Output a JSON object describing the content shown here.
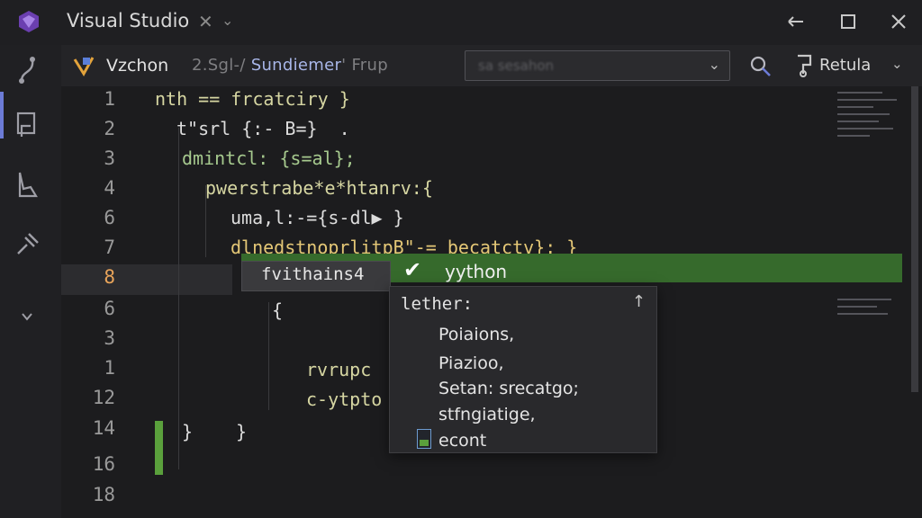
{
  "window": {
    "title": "Visual Studio",
    "close_glyph": "✕",
    "chevron_glyph": "⌄"
  },
  "toolbar": {
    "file_name": "Vzchon",
    "path_prefix": "2.Sgl-/",
    "path_highlight": "Sundiemer",
    "path_suffix": "' Frup",
    "dropdown_value": "sa sesahon",
    "run_label": "Retula"
  },
  "editor": {
    "current_line_number": "8",
    "line_numbers": [
      "1",
      "2",
      "3",
      "4",
      "6",
      "7",
      "8",
      "6",
      "3",
      "1",
      "12",
      "14",
      "16",
      "18"
    ],
    "lines": [
      "nth == frcatciry }",
      "t\"srl {:- B=}  .",
      "dmintcl: {s=al};",
      "pwerstrabe*e*htanrv:{",
      "uma,l:-={s-dl▶ }",
      "dlnedstnoprlitpB\"-= becatctv}: }",
      "fvithains4",
      "{",
      "",
      "rvrupc",
      "c-ytpto",
      "}",
      "}",
      ""
    ]
  },
  "suggestion": {
    "input_text": "fvithains4",
    "label": "yython"
  },
  "popup": {
    "header": "lether:",
    "items": [
      "Poiaions,",
      "Piazioo,",
      "Setan: srecatgo;",
      "stfngiatige,",
      "econt"
    ]
  },
  "colors": {
    "accent": "#6c7bd6",
    "suggest_green": "#366a2c",
    "gutter_green": "#5aa03c",
    "current_line_number": "#e8a45a"
  },
  "icons": {
    "app": "visual-studio-logo-icon",
    "minimize": "minimize-icon",
    "maximize": "maximize-icon",
    "close": "close-icon",
    "search": "search-icon",
    "run": "run-icon"
  }
}
